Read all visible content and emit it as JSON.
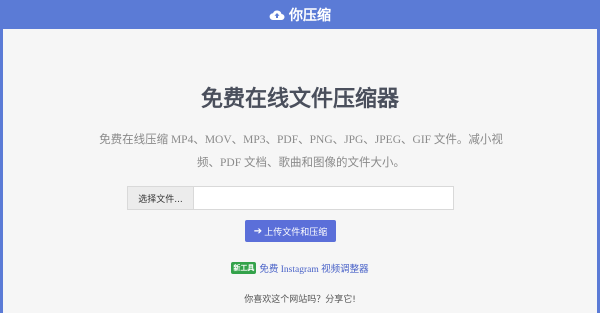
{
  "header": {
    "title": "你压缩",
    "icon": "cloud-upload-icon"
  },
  "main": {
    "headline": "免费在线文件压缩器",
    "description": "免费在线压缩 MP4、MOV、MP3、PDF、PNG、JPG、JPEG、GIF 文件。减小视频、PDF 文档、歌曲和图像的文件大小。",
    "file_picker": {
      "button_label": "选择文件...",
      "value": ""
    },
    "upload_button": {
      "icon": "arrow-right-icon",
      "label": "上传文件和压缩"
    },
    "promo": {
      "badge": "新工具",
      "link_text": "免费 Instagram 视频调整器"
    },
    "share_text": "你喜欢这个网站吗？分享它!"
  },
  "colors": {
    "brand": "#5b7bd6",
    "button": "#5b6fd9",
    "badge": "#33a24a",
    "link": "#4a63c8"
  }
}
